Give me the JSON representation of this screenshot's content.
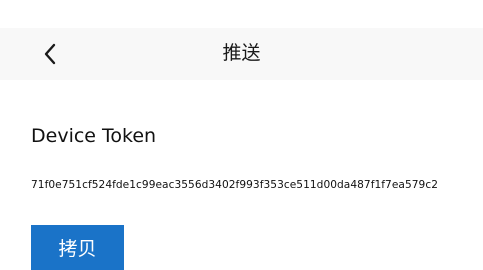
{
  "nav": {
    "title": "推送",
    "back_icon": "chevron-left-icon"
  },
  "device_token": {
    "label": "Device Token",
    "value": "71f0e751cf524fde1c99eac3556d3402f993f353ce511d00da487f1f7ea579c2"
  },
  "actions": {
    "copy_label": "拷贝"
  },
  "colors": {
    "nav_background": "#f8f8f8",
    "button_background": "#1a73c8",
    "button_text": "#ffffff",
    "text": "#111111"
  }
}
